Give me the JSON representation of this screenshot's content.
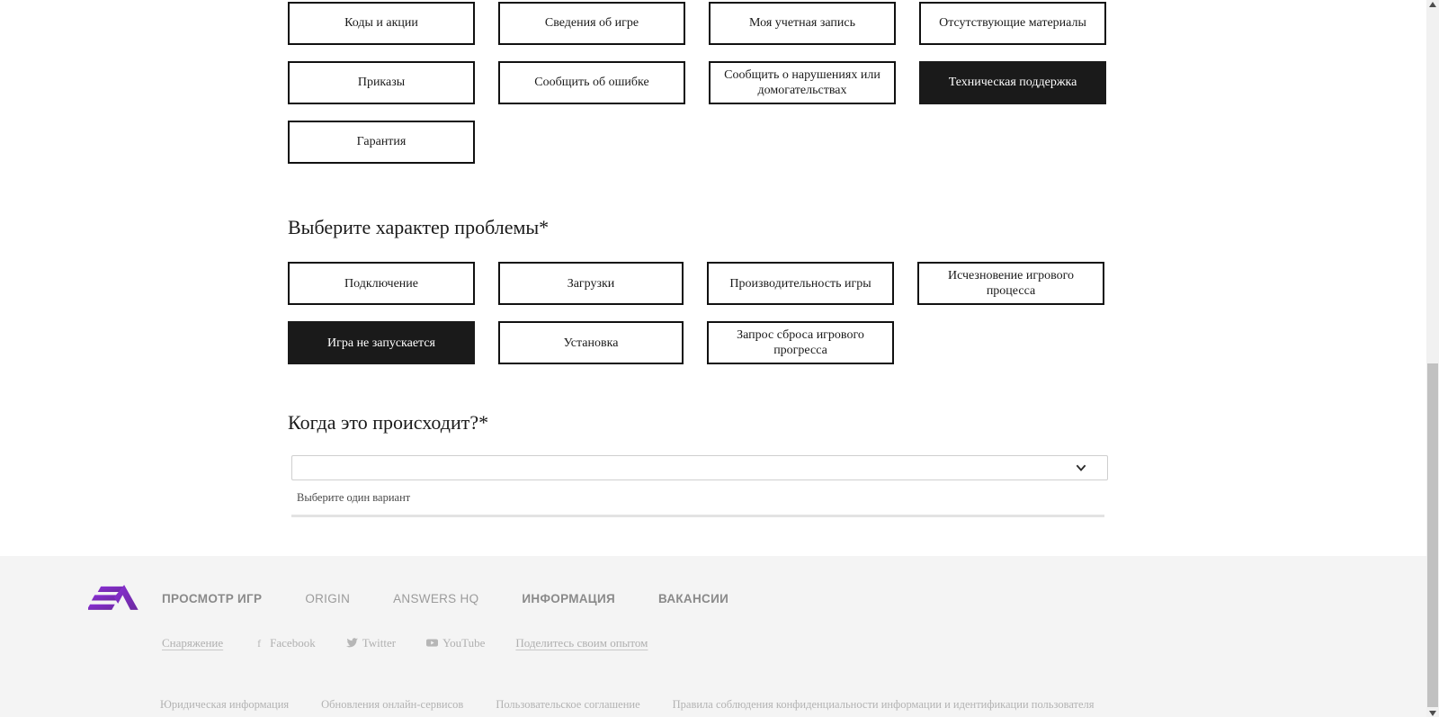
{
  "topic": {
    "options": [
      {
        "label": "Коды и акции",
        "selected": false
      },
      {
        "label": "Сведения об игре",
        "selected": false
      },
      {
        "label": "Моя учетная запись",
        "selected": false
      },
      {
        "label": "Отсутствующие материалы",
        "selected": false
      },
      {
        "label": "Приказы",
        "selected": false
      },
      {
        "label": "Сообщить об ошибке",
        "selected": false
      },
      {
        "label": "Сообщить о нарушениях или домогательствах",
        "selected": false
      },
      {
        "label": "Техническая поддержка",
        "selected": true
      },
      {
        "label": "Гарантия",
        "selected": false
      }
    ]
  },
  "issue": {
    "heading": "Выберите характер проблемы*",
    "options": [
      {
        "label": "Подключение",
        "selected": false
      },
      {
        "label": "Загрузки",
        "selected": false
      },
      {
        "label": "Производительность игры",
        "selected": false
      },
      {
        "label": "Исчезновение игрового процесса",
        "selected": false
      },
      {
        "label": "Игра не запускается",
        "selected": true
      },
      {
        "label": "Установка",
        "selected": false
      },
      {
        "label": "Запрос сброса игрового прогресса",
        "selected": false
      }
    ]
  },
  "when": {
    "heading": "Когда это происходит?*",
    "select_value": "",
    "select_placeholder": "",
    "helper_text": "Выберите один вариант",
    "chevron_icon": "chevron-down-icon"
  },
  "footer": {
    "logo_alt": "ea-logo",
    "logo_color": "#7B2FBE",
    "nav": [
      {
        "label": "ПРОСМОТР ИГР",
        "strong": true
      },
      {
        "label": "ORIGIN",
        "strong": false
      },
      {
        "label": "ANSWERS HQ",
        "strong": false
      },
      {
        "label": "ИНФОРМАЦИЯ",
        "strong": true
      },
      {
        "label": "ВАКАНСИИ",
        "strong": true
      }
    ],
    "social": [
      {
        "label": "Снаряжение",
        "icon": "",
        "underlined": true
      },
      {
        "label": "Facebook",
        "icon": "f",
        "underlined": false
      },
      {
        "label": "Twitter",
        "icon": "twitter-icon",
        "underlined": false
      },
      {
        "label": "YouTube",
        "icon": "youtube-icon",
        "underlined": false
      },
      {
        "label": "Поделитесь своим опытом",
        "icon": "",
        "underlined": true
      }
    ],
    "legal": [
      "Юридическая информация",
      "Обновления онлайн-сервисов",
      "Пользовательское соглашение",
      "Правила соблюдения конфиденциальности информации и идентификации пользователя"
    ]
  },
  "scrollbar": {
    "up_icon": "scroll-up-arrow-icon",
    "down_icon": "scroll-down-arrow-icon"
  },
  "colors": {
    "selected_bg": "#1a1a1a",
    "button_border": "#111111",
    "footer_bg": "#f4f4f4",
    "scroll_thumb": "#c1c1c1"
  }
}
